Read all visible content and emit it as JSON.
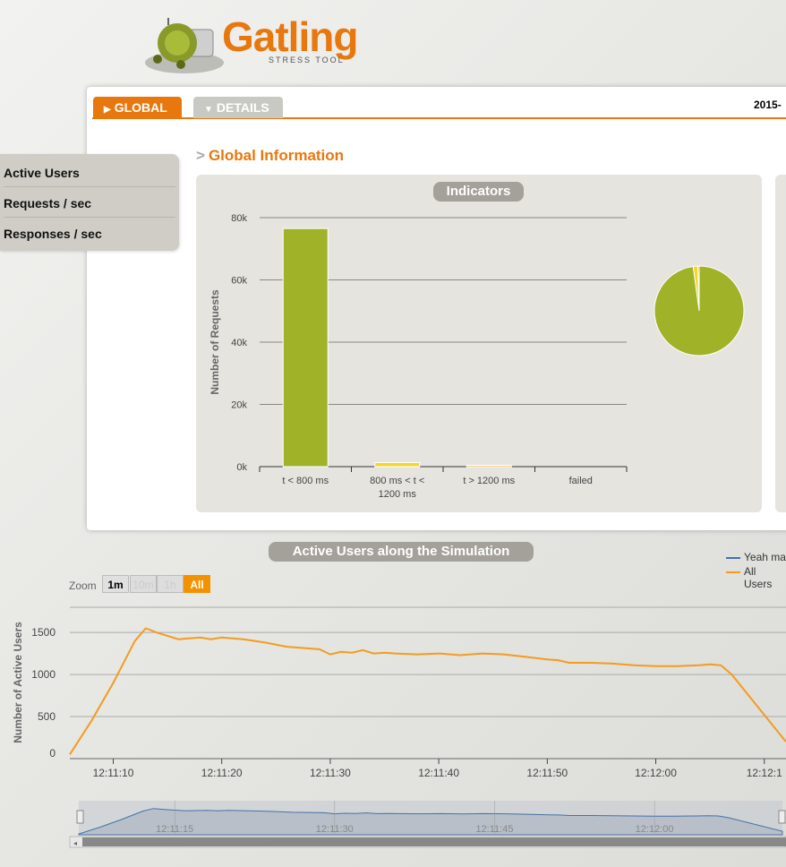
{
  "brand": {
    "name": "Gatling",
    "tagline": "STRESS TOOL"
  },
  "tabs": [
    {
      "label": "GLOBAL",
      "active": true
    },
    {
      "label": "DETAILS",
      "active": false
    }
  ],
  "date_text": "2015-",
  "side_menu": [
    "Active Users",
    "Requests / sec",
    "Responses / sec"
  ],
  "section_title": "Global Information",
  "indicators": {
    "title": "Indicators",
    "chart_data": {
      "type": "bar",
      "title": "Indicators",
      "ylabel": "Number of Requests",
      "categories": [
        "t < 800 ms",
        "800 ms < t < 1200 ms",
        "t > 1200 ms",
        "failed"
      ],
      "values": [
        76500,
        1300,
        400,
        0
      ],
      "colors": [
        "#a0b228",
        "#f0d828",
        "#e8a018",
        "#f15b4f"
      ],
      "ylim": [
        0,
        80000
      ],
      "yticks": [
        "0k",
        "20k",
        "40k",
        "60k",
        "80k"
      ],
      "grid": true
    },
    "pie_data": {
      "type": "pie",
      "labels": [
        "t < 800 ms",
        "800 ms < t < 1200 ms",
        "t > 1200 ms",
        "failed"
      ],
      "values": [
        76500,
        1300,
        400,
        0
      ],
      "colors": [
        "#a0b228",
        "#f0d828",
        "#e8a018",
        "#f15b4f"
      ]
    }
  },
  "active_users": {
    "title": "Active Users along the Simulation",
    "zoom_label": "Zoom",
    "zoom_buttons": [
      "1m",
      "10m",
      "1h",
      "All"
    ],
    "legend": [
      "Yeah ma",
      "All Users"
    ],
    "legend_colors": [
      "#4572a7",
      "#f39c1f"
    ],
    "chart_data": {
      "type": "line",
      "ylabel": "Number of Active Users",
      "ylim": [
        0,
        1800
      ],
      "yticks": [
        "0",
        "500",
        "1000",
        "1500"
      ],
      "x_range": [
        "12:11:06",
        "12:12:12"
      ],
      "xticks": [
        "12:11:10",
        "12:11:20",
        "12:11:30",
        "12:11:40",
        "12:11:50",
        "12:12:00",
        "12:12:1"
      ],
      "navigator_ticks": [
        "12:11:15",
        "12:11:30",
        "12:11:45",
        "12:12:00"
      ],
      "series": [
        {
          "name": "All Users",
          "color": "#f39c1f",
          "x": [
            "12:11:06",
            "12:11:08",
            "12:11:10",
            "12:11:12",
            "12:11:13",
            "12:11:14",
            "12:11:16",
            "12:11:17",
            "12:11:18",
            "12:11:19",
            "12:11:20",
            "12:11:21",
            "12:11:22",
            "12:11:24",
            "12:11:26",
            "12:11:29",
            "12:11:30",
            "12:11:31",
            "12:11:32",
            "12:11:33",
            "12:11:34",
            "12:11:35",
            "12:11:36",
            "12:11:38",
            "12:11:40",
            "12:11:42",
            "12:11:44",
            "12:11:46",
            "12:11:48",
            "12:11:50",
            "12:11:51",
            "12:11:52",
            "12:11:54",
            "12:11:56",
            "12:11:58",
            "12:12:00",
            "12:12:02",
            "12:12:04",
            "12:12:05",
            "12:12:06",
            "12:12:07",
            "12:12:12"
          ],
          "y": [
            50,
            450,
            900,
            1400,
            1550,
            1500,
            1420,
            1430,
            1440,
            1420,
            1440,
            1430,
            1420,
            1380,
            1330,
            1300,
            1240,
            1270,
            1260,
            1290,
            1250,
            1260,
            1250,
            1240,
            1250,
            1230,
            1250,
            1240,
            1210,
            1180,
            1170,
            1140,
            1140,
            1130,
            1110,
            1100,
            1100,
            1110,
            1120,
            1110,
            1000,
            200
          ]
        }
      ]
    }
  }
}
